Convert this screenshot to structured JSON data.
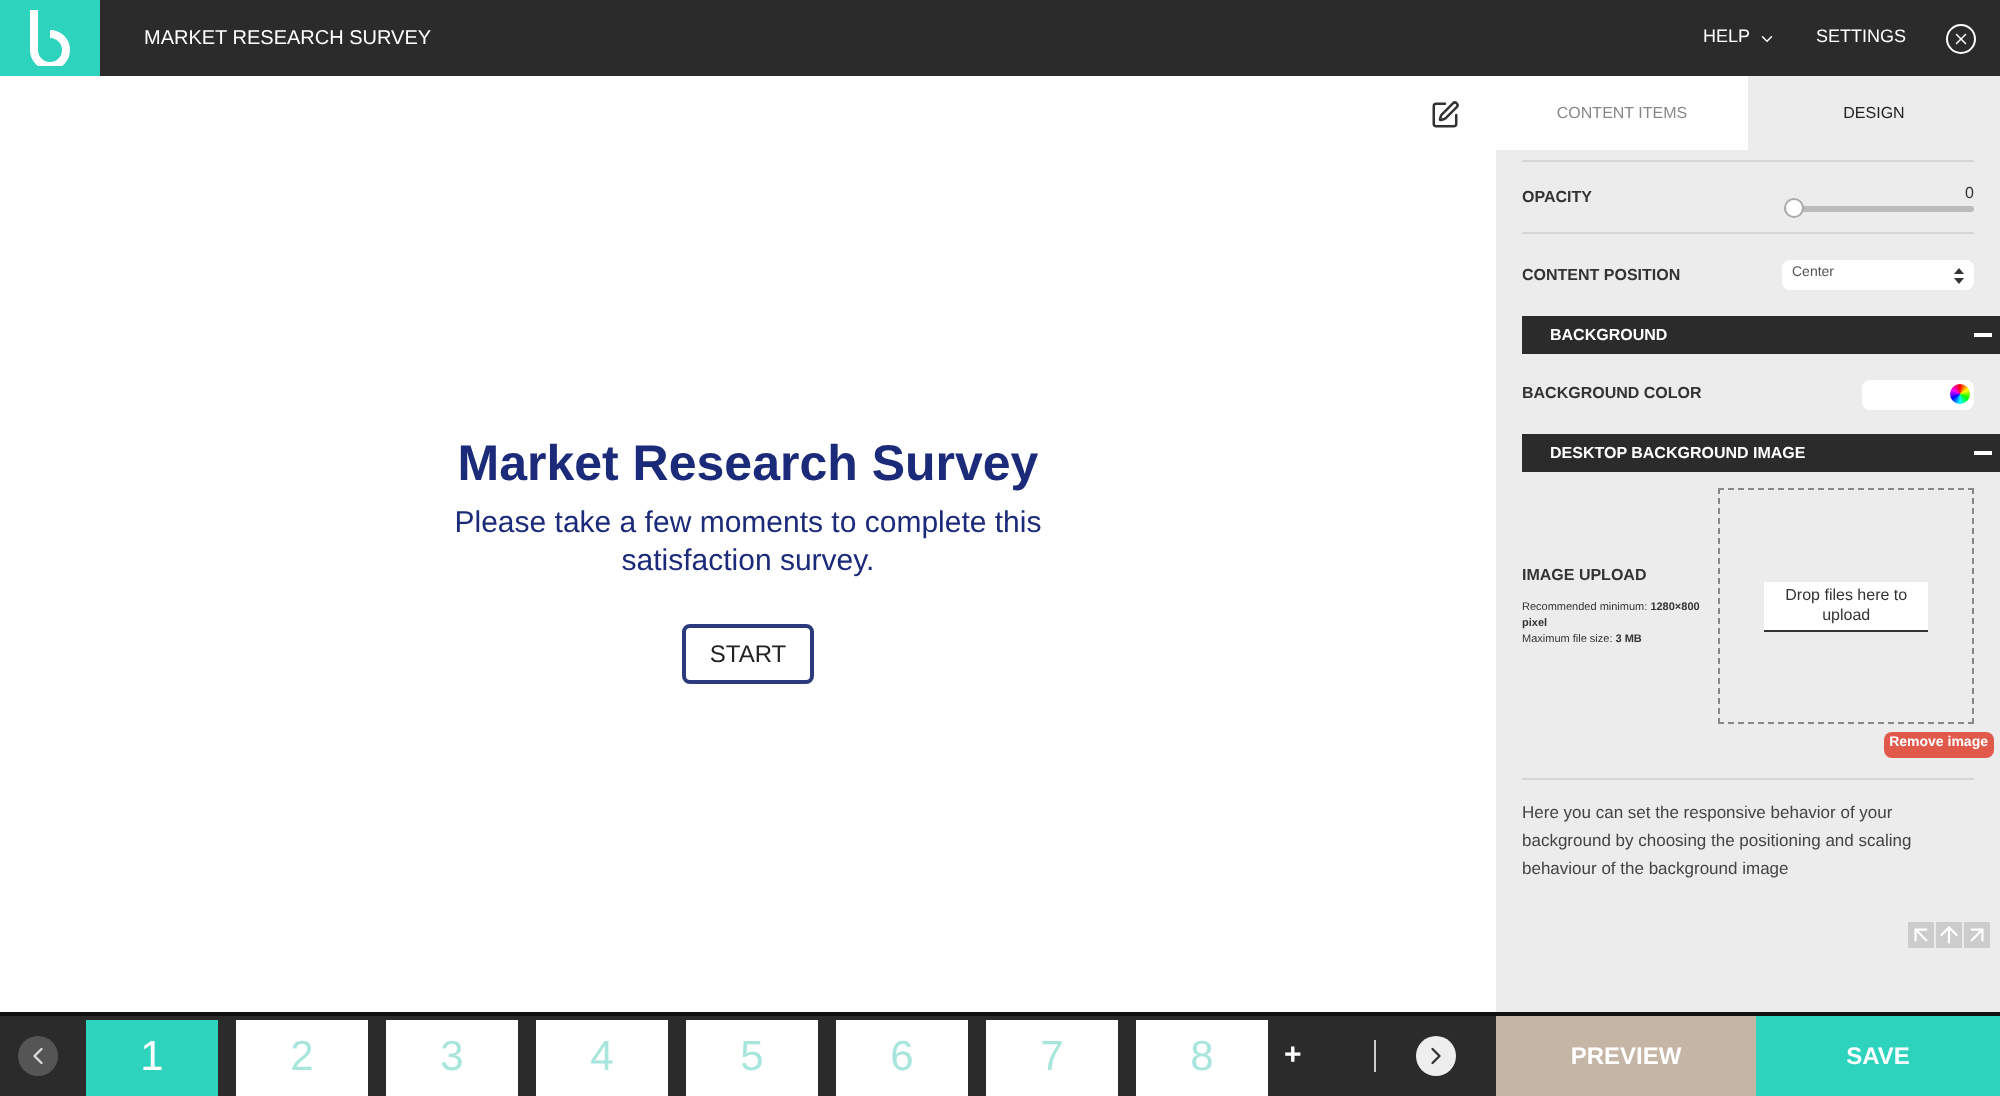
{
  "header": {
    "title": "MARKET RESEARCH SURVEY",
    "menu": [
      {
        "label": "HELP",
        "kind": "dropdown"
      },
      {
        "label": "SETTINGS",
        "kind": "link"
      }
    ]
  },
  "canvas": {
    "title": "Market Research Survey",
    "subtitle": "Please take a few moments to complete this satisfaction survey.",
    "button": "START"
  },
  "panel": {
    "tabs": [
      {
        "label": "CONTENT ITEMS",
        "selected": false
      },
      {
        "label": "DESIGN",
        "selected": true
      }
    ],
    "opacity": {
      "label": "OPACITY",
      "reading": "0",
      "level": 0
    },
    "content_position": {
      "label": "CONTENT POSITION",
      "value": "Center"
    },
    "sections": [
      {
        "title": "BACKGROUND",
        "expanded": true
      },
      {
        "title": "DESKTOP BACKGROUND IMAGE",
        "expanded": true
      }
    ],
    "background_color": {
      "label": "BACKGROUND COLOR"
    },
    "image_upload": {
      "label": "IMAGE UPLOAD",
      "hint": "Recommended minimum: **1280×800 pixel**",
      "max": "Maximum file size: **3 MB**",
      "drop": "Drop files here to upload",
      "remove": "Remove image"
    },
    "help_text": "Here you can set the responsive behavior of your background by choosing the positioning and scaling behaviour of the background image"
  },
  "pages": [
    {
      "label": "1",
      "selected": true
    },
    {
      "label": "2",
      "selected": false
    },
    {
      "label": "3",
      "selected": false
    },
    {
      "label": "4",
      "selected": false
    },
    {
      "label": "5",
      "selected": false
    },
    {
      "label": "6",
      "selected": false
    },
    {
      "label": "7",
      "selected": false
    },
    {
      "label": "8",
      "selected": false
    }
  ],
  "add_page": "+",
  "actions": [
    "PREVIEW",
    "SAVE"
  ]
}
